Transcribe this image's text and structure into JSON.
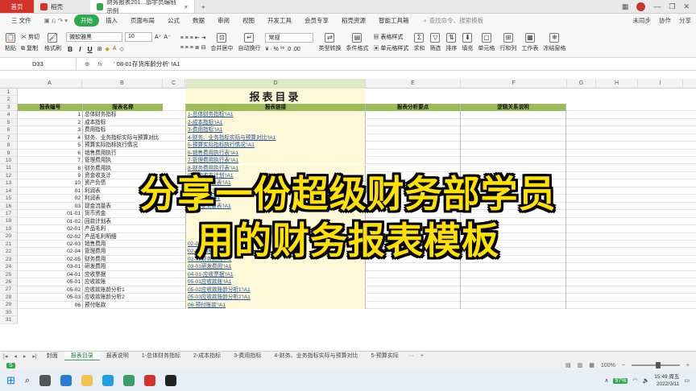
{
  "window": {
    "tabs": [
      {
        "label": "首页"
      },
      {
        "label": "稻壳"
      },
      {
        "label": "财务报表201...部学员编制示例"
      }
    ],
    "new_tab": "+"
  },
  "menu": {
    "items": [
      "三 文件",
      "开始",
      "插入",
      "页面布局",
      "公式",
      "数据",
      "审阅",
      "视图",
      "开发工具",
      "会员专享",
      "稻壳资源",
      "智能工具箱"
    ],
    "active": "开始",
    "search_placeholder": "查找命令、搜索模板",
    "right": [
      "未同步",
      "协作",
      "分享"
    ]
  },
  "ribbon": {
    "paste": "粘贴",
    "cut": "剪切",
    "copy": "复制",
    "format_painter": "格式刷",
    "font_name": "微软雅黑",
    "font_size": "10",
    "bold": "B",
    "italic": "I",
    "underline": "U",
    "merge": "合并居中",
    "wrap": "自动换行",
    "number_format": "常规",
    "type_convert": "类型转换",
    "cond_format": "条件格式",
    "cell_style": "单元格样式",
    "table_style": "表格样式",
    "sum": "求和",
    "filter": "筛选",
    "sort": "排序",
    "fill": "填充",
    "cell": "单元格",
    "rowcol": "行和列",
    "worksheet": "工作表",
    "freeze": "冻结窗格"
  },
  "formula_bar": {
    "cell_ref": "D33",
    "fx": "fx",
    "content": "' 08-01存货库龄分析' !A1"
  },
  "columns": [
    "A",
    "B",
    "C",
    "D",
    "E",
    "F",
    "G",
    "H",
    "I"
  ],
  "rows_numbers": [
    "1",
    "2",
    "3",
    "4",
    "5",
    "6",
    "7",
    "8",
    "9",
    "10",
    "11",
    "12",
    "13",
    "14",
    "15",
    "16",
    "17",
    "18",
    "19",
    "20",
    "21",
    "22",
    "23",
    "24",
    "25",
    "26",
    "27",
    "28",
    "29",
    "30",
    "31"
  ],
  "sheet": {
    "title": "报表目录",
    "headers": [
      "报表编号",
      "报表名称",
      "报表链接",
      "报表分析要点",
      "逻辑关系说明"
    ],
    "rows": [
      {
        "no": "1",
        "name": "总体财务指标",
        "link": "1-总体财务指标'!A1"
      },
      {
        "no": "2",
        "name": "成本指标",
        "link": "2-成本指标'!A1"
      },
      {
        "no": "3",
        "name": "费用指标",
        "link": "3-费用指标'!A1"
      },
      {
        "no": "4",
        "name": "财务、业务指标实际与预算对比",
        "link": "4-财务、业务指标实际与预算对比'!A1"
      },
      {
        "no": "5",
        "name": "预算实际指标执行情况",
        "link": "5-预算实际指标执行情况'!A1"
      },
      {
        "no": "6",
        "name": "销售费用执行",
        "link": "6-销售费用执行表'!A1"
      },
      {
        "no": "7",
        "name": "管理费用执",
        "link": "7-管理费用执行表'!A1"
      },
      {
        "no": "8",
        "name": "财务费用执",
        "link": "8-财务费用执行表'!A1"
      },
      {
        "no": "9",
        "name": "资金收支计",
        "link": "9-资金收支计划'!A1"
      },
      {
        "no": "10",
        "name": "资产负债",
        "link": "10-资产负债表'!A1"
      },
      {
        "no": "01",
        "name": "利润表",
        "link": "01-利润表'!A1"
      },
      {
        "no": "02",
        "name": "利润表",
        "link": "02-利润表'!A1"
      },
      {
        "no": "03",
        "name": "现金流量表",
        "link": "03-现金流量表'!A1"
      },
      {
        "no": "01-01",
        "name": "货币资金",
        "link": ""
      },
      {
        "no": "01-02",
        "name": "回款计划表",
        "link": ""
      },
      {
        "no": "02-01",
        "name": "产品毛利",
        "link": ""
      },
      {
        "no": "02-02",
        "name": "产品毛利明细",
        "link": ""
      },
      {
        "no": "02-03",
        "name": "销售费用",
        "link": "02-03销售费用'!A1"
      },
      {
        "no": "02-04",
        "name": "管理费用",
        "link": "02-04管理费用'!A1"
      },
      {
        "no": "02-05",
        "name": "财务费用",
        "link": "02-05财务费用'!A1"
      },
      {
        "no": "03-01",
        "name": "研发费用",
        "link": "03-01研发费用'!A1"
      },
      {
        "no": "04-01",
        "name": "应收票据",
        "link": "04-01-应收票据'!A1"
      },
      {
        "no": "05-01",
        "name": "应收款账",
        "link": "05-01应收款账'!A1"
      },
      {
        "no": "05-02",
        "name": "应收款账龄分析1",
        "link": "05-02应收款账龄分析1'!A1"
      },
      {
        "no": "05-03",
        "name": "应收款账龄分析2",
        "link": "05-03应收款账龄分析2'!A1"
      },
      {
        "no": "06",
        "name": "预付账款",
        "link": "06-预付账款'!A1"
      }
    ]
  },
  "overlay": {
    "line1": "分享一份超级财务部学员",
    "line2": "用的财务报表模板"
  },
  "sheet_tabs": [
    "封面",
    "报表目录",
    "报表说明",
    "1-总体财务指标",
    "2-成本指标",
    "3-费用指标",
    "4-财务、业务指标实际与预算对比",
    "5-预算实际"
  ],
  "active_sheet": "报表目录",
  "status": {
    "zoom": "100%",
    "zoom_level": 0.5
  },
  "taskbar": {
    "time": "15:49 周五",
    "date": "2022/3/11",
    "battery": "97%"
  }
}
